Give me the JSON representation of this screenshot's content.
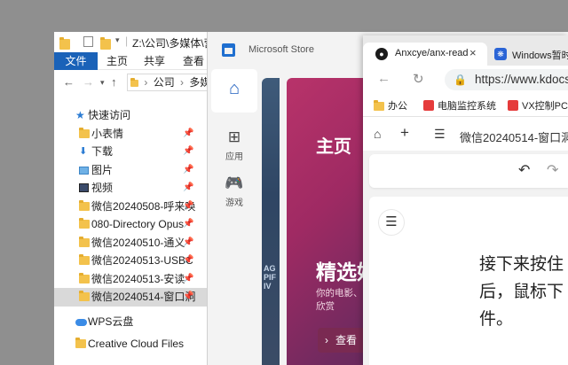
{
  "explorer": {
    "title_path": "Z:\\公司\\多媒体\\营",
    "ribbon_tabs": [
      "文件",
      "主页",
      "共享",
      "查看"
    ],
    "breadcrumb": [
      "公司",
      "多媒"
    ],
    "nav": {
      "quick_access": "快速访问",
      "items": [
        {
          "label": "小表情",
          "pinned": true
        },
        {
          "label": "下载",
          "pinned": true
        },
        {
          "label": "图片",
          "pinned": true
        },
        {
          "label": "视频",
          "pinned": true
        },
        {
          "label": "微信20240508-呼来唤",
          "pinned": true
        },
        {
          "label": "080-Directory Opus",
          "pinned": true
        },
        {
          "label": "微信20240510-通义",
          "pinned": true
        },
        {
          "label": "微信20240513-USBC",
          "pinned": true
        },
        {
          "label": "微信20240513-安读",
          "pinned": true
        },
        {
          "label": "微信20240514-窗口洞",
          "pinned": true
        }
      ],
      "wps": "WPS云盘",
      "creative_cloud": "Creative Cloud Files"
    }
  },
  "store": {
    "title": "Microsoft Store",
    "nav": {
      "apps": "应用",
      "games": "游戏"
    },
    "hero_left_text": "AG\nPIF\nIV",
    "hero": {
      "title": "主页",
      "featured": "精选娱",
      "description": "你的电影、欣赏",
      "button": "查看"
    }
  },
  "browser": {
    "tabs": [
      {
        "title": "Anxcye/anx-reade"
      },
      {
        "title": "Windows暂时"
      }
    ],
    "url": "https://www.kdocs.c",
    "bookmarks": [
      "办公",
      "电脑监控系统",
      "VX控制PC"
    ],
    "doc_title": "微信20240514-窗口洞",
    "doc_lines": [
      "接下来按住",
      "后，鼠标下",
      "件。"
    ]
  }
}
